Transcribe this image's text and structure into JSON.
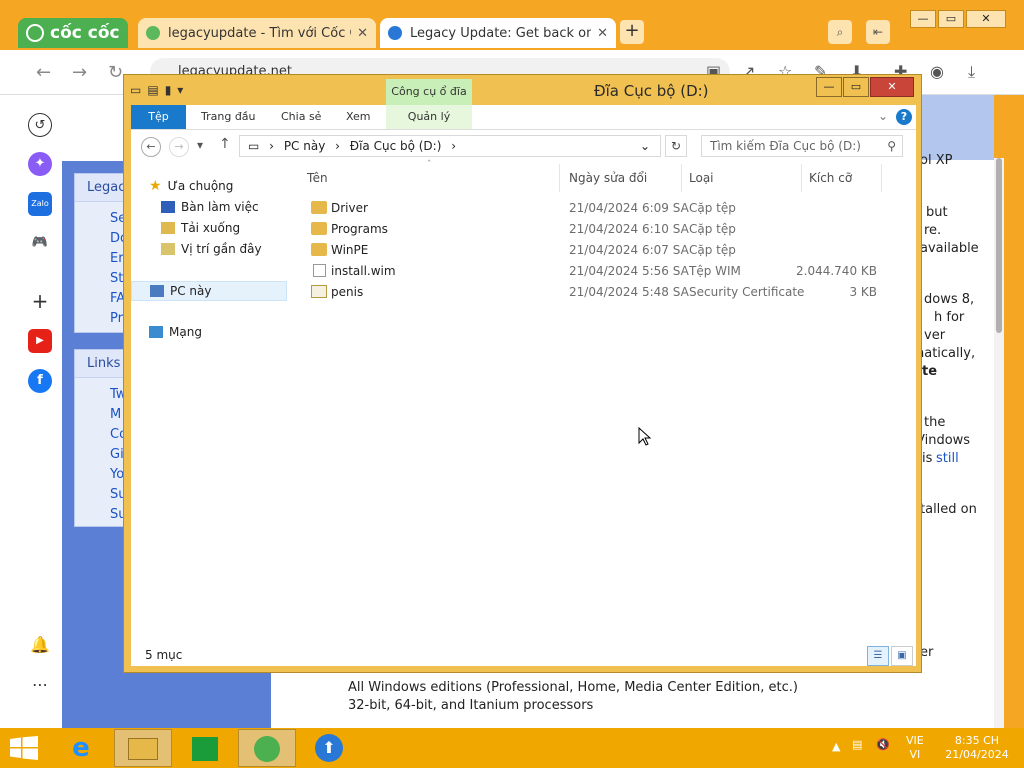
{
  "browser": {
    "brand": "cốc cốc",
    "tabs": [
      {
        "title": "legacyupdate - Tìm với Cốc C",
        "active": false
      },
      {
        "title": "Legacy Update: Get back onl",
        "active": true
      }
    ],
    "new_tab": "+",
    "url": "legacyupdate.net",
    "window_controls": [
      "—",
      "▭",
      "✕"
    ]
  },
  "page": {
    "box1_title": "Legac",
    "box1_items": [
      "Se",
      "Do",
      "Er",
      "St",
      "FA",
      "Pr"
    ],
    "box2_title": "Links",
    "box2_items": [
      "Tw",
      "M",
      "Co",
      "Gi",
      "Yo",
      "Su",
      "Su"
    ],
    "right_fragments": [
      "ol XP",
      "but",
      "re.",
      "available",
      "dows 8,",
      "h for",
      "ver",
      "natically,",
      "te",
      "the",
      "Vindows",
      "is",
      "still",
      "talled on",
      "er"
    ],
    "bottom_line1": "All Windows editions (Professional, Home, Media Center Edition, etc.)",
    "bottom_line2": "32-bit, 64-bit, and Itanium processors"
  },
  "explorer": {
    "title": "Đĩa Cục bộ (D:)",
    "context_tab": "Công cụ ổ đĩa",
    "ribbon_tabs": [
      "Tệp",
      "Trang đầu",
      "Chia sẻ",
      "Xem"
    ],
    "context_subtab": "Quản lý",
    "breadcrumb": [
      "PC này",
      "Đĩa Cục bộ (D:)"
    ],
    "search_placeholder": "Tìm kiếm Đĩa Cục bộ (D:)",
    "nav_tree": [
      {
        "label": "Ưa chuộng",
        "icon": "star-icon",
        "level": 0
      },
      {
        "label": "Bàn làm việc",
        "icon": "desktop-icon",
        "level": 1
      },
      {
        "label": "Tải xuống",
        "icon": "download-icon",
        "level": 1
      },
      {
        "label": "Vị trí gần đây",
        "icon": "recent-icon",
        "level": 1
      },
      {
        "label": "PC này",
        "icon": "computer-icon",
        "level": 0,
        "selected": true
      },
      {
        "label": "Mạng",
        "icon": "network-icon",
        "level": 0
      }
    ],
    "columns": [
      "Tên",
      "Ngày sửa đổi",
      "Loại",
      "Kích cỡ"
    ],
    "files": [
      {
        "name": "Driver",
        "date": "21/04/2024 6:09 SA",
        "type": "Cặp tệp",
        "size": "",
        "icon": "folder-icon"
      },
      {
        "name": "Programs",
        "date": "21/04/2024 6:10 SA",
        "type": "Cặp tệp",
        "size": "",
        "icon": "folder-icon"
      },
      {
        "name": "WinPE",
        "date": "21/04/2024 6:07 SA",
        "type": "Cặp tệp",
        "size": "",
        "icon": "folder-icon"
      },
      {
        "name": "install.wim",
        "date": "21/04/2024 5:56 SA",
        "type": "Tệp WIM",
        "size": "2.044.740 KB",
        "icon": "file-icon"
      },
      {
        "name": "penis",
        "date": "21/04/2024 5:48 SA",
        "type": "Security Certificate",
        "size": "3 KB",
        "icon": "certificate-icon"
      }
    ],
    "status": "5 mục"
  },
  "taskbar": {
    "lang": "VIE",
    "lang2": "VI",
    "time": "8:35 CH",
    "date": "21/04/2024"
  },
  "colors": {
    "accent": "#f5a623",
    "ribbon_blue": "#1979ca",
    "drive_tools": "#c9efb8"
  }
}
